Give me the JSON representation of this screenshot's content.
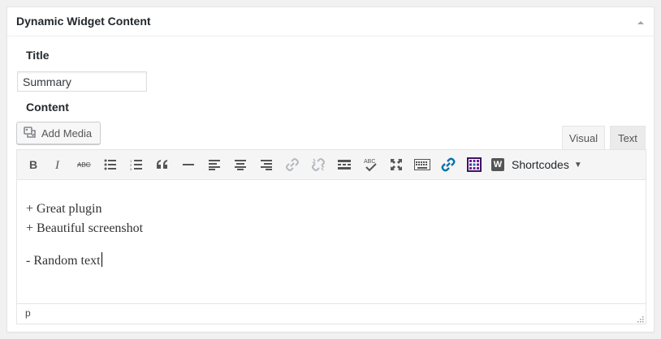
{
  "metabox": {
    "title": "Dynamic Widget Content"
  },
  "fields": {
    "title_label": "Title",
    "title_value": "Summary",
    "content_label": "Content"
  },
  "media": {
    "add_media_label": "Add Media"
  },
  "tabs": [
    {
      "label": "Visual",
      "active": true
    },
    {
      "label": "Text",
      "active": false
    }
  ],
  "toolbar": {
    "buttons": [
      {
        "name": "bold-icon"
      },
      {
        "name": "italic-icon"
      },
      {
        "name": "strikethrough-icon",
        "glyph": "ABC"
      },
      {
        "name": "bulleted-list-icon"
      },
      {
        "name": "numbered-list-icon"
      },
      {
        "name": "blockquote-icon"
      },
      {
        "name": "horizontal-line-icon"
      },
      {
        "name": "align-left-icon"
      },
      {
        "name": "align-center-icon"
      },
      {
        "name": "align-right-icon"
      },
      {
        "name": "insert-link-icon"
      },
      {
        "name": "remove-link-icon"
      },
      {
        "name": "read-more-icon"
      },
      {
        "name": "spellcheck-icon",
        "glyph": "ABC"
      },
      {
        "name": "fullscreen-icon"
      },
      {
        "name": "toolbar-toggle-icon"
      },
      {
        "name": "link-widget-icon"
      },
      {
        "name": "widget-grid-icon"
      }
    ],
    "shortcodes_badge": "W",
    "shortcodes_label": "Shortcodes",
    "shortcodes_caret": "▼",
    "accent_blue": "#0073aa",
    "accent_purple": "#6f1b9b"
  },
  "editor": {
    "paragraphs": [
      "+ Great plugin",
      "+ Beautiful screenshot",
      "- Random text"
    ]
  },
  "statusbar": {
    "path": "p"
  }
}
